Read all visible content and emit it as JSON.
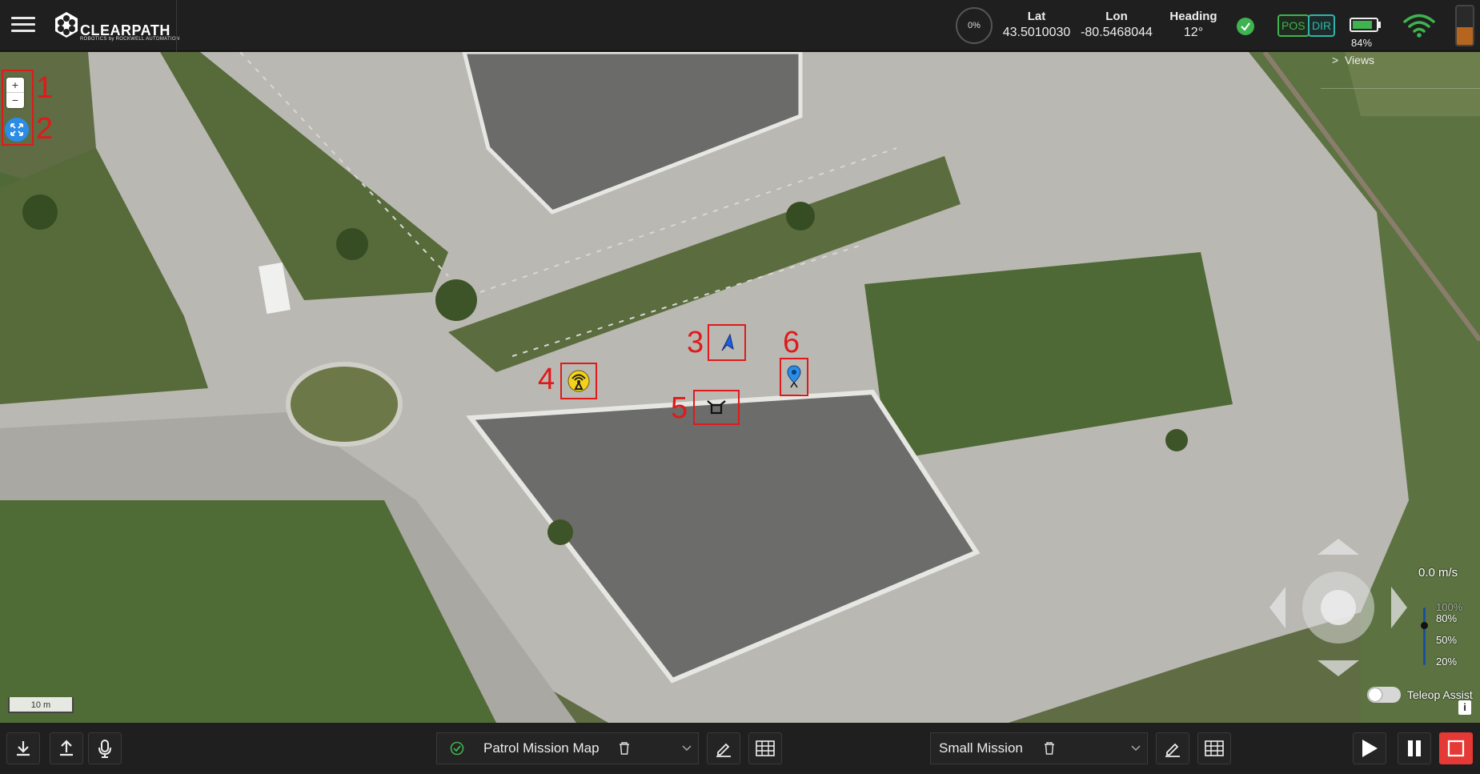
{
  "app": {
    "brand": "CLEARPATH",
    "brand_sub": "ROBOTICS  by ROCKWELL AUTOMATION"
  },
  "topbar": {
    "progress_pct": "0%",
    "lat_label": "Lat",
    "lat_value": "43.5010030",
    "lon_label": "Lon",
    "lon_value": "-80.5468044",
    "heading_label": "Heading",
    "heading_value": "12°",
    "pos_badge": "POS",
    "dir_badge": "DIR",
    "battery_pct": "84%",
    "battery_level": 0.84,
    "estop_level": 0.45,
    "colors": {
      "ok": "#3fb34f",
      "dir": "#2fb5a8",
      "estop": "#b5651d"
    }
  },
  "map": {
    "views_label": "Views",
    "speed_label": "0.0 m/s",
    "speed_scale": [
      "100%",
      "80%",
      "50%",
      "20%"
    ],
    "speed_level": "80%",
    "teleop_assist_label": "Teleop Assist",
    "teleop_assist_on": false,
    "info_label": "i",
    "scale_label": "10 m",
    "annotations": [
      "1",
      "2",
      "3",
      "4",
      "5",
      "6"
    ],
    "markers": [
      "robot-heading-arrow-icon",
      "base-station-icon",
      "docking-station-icon",
      "waypoint-pin-icon"
    ]
  },
  "bottombar": {
    "map_select": "Patrol Mission Map",
    "mission_select": "Small Mission",
    "icons": [
      "download-icon",
      "upload-icon",
      "microphone-icon",
      "edit-icon",
      "grid-icon",
      "trash-icon",
      "play-icon",
      "pause-icon",
      "stop-icon"
    ],
    "colors": {
      "stop": "#e53935"
    }
  }
}
